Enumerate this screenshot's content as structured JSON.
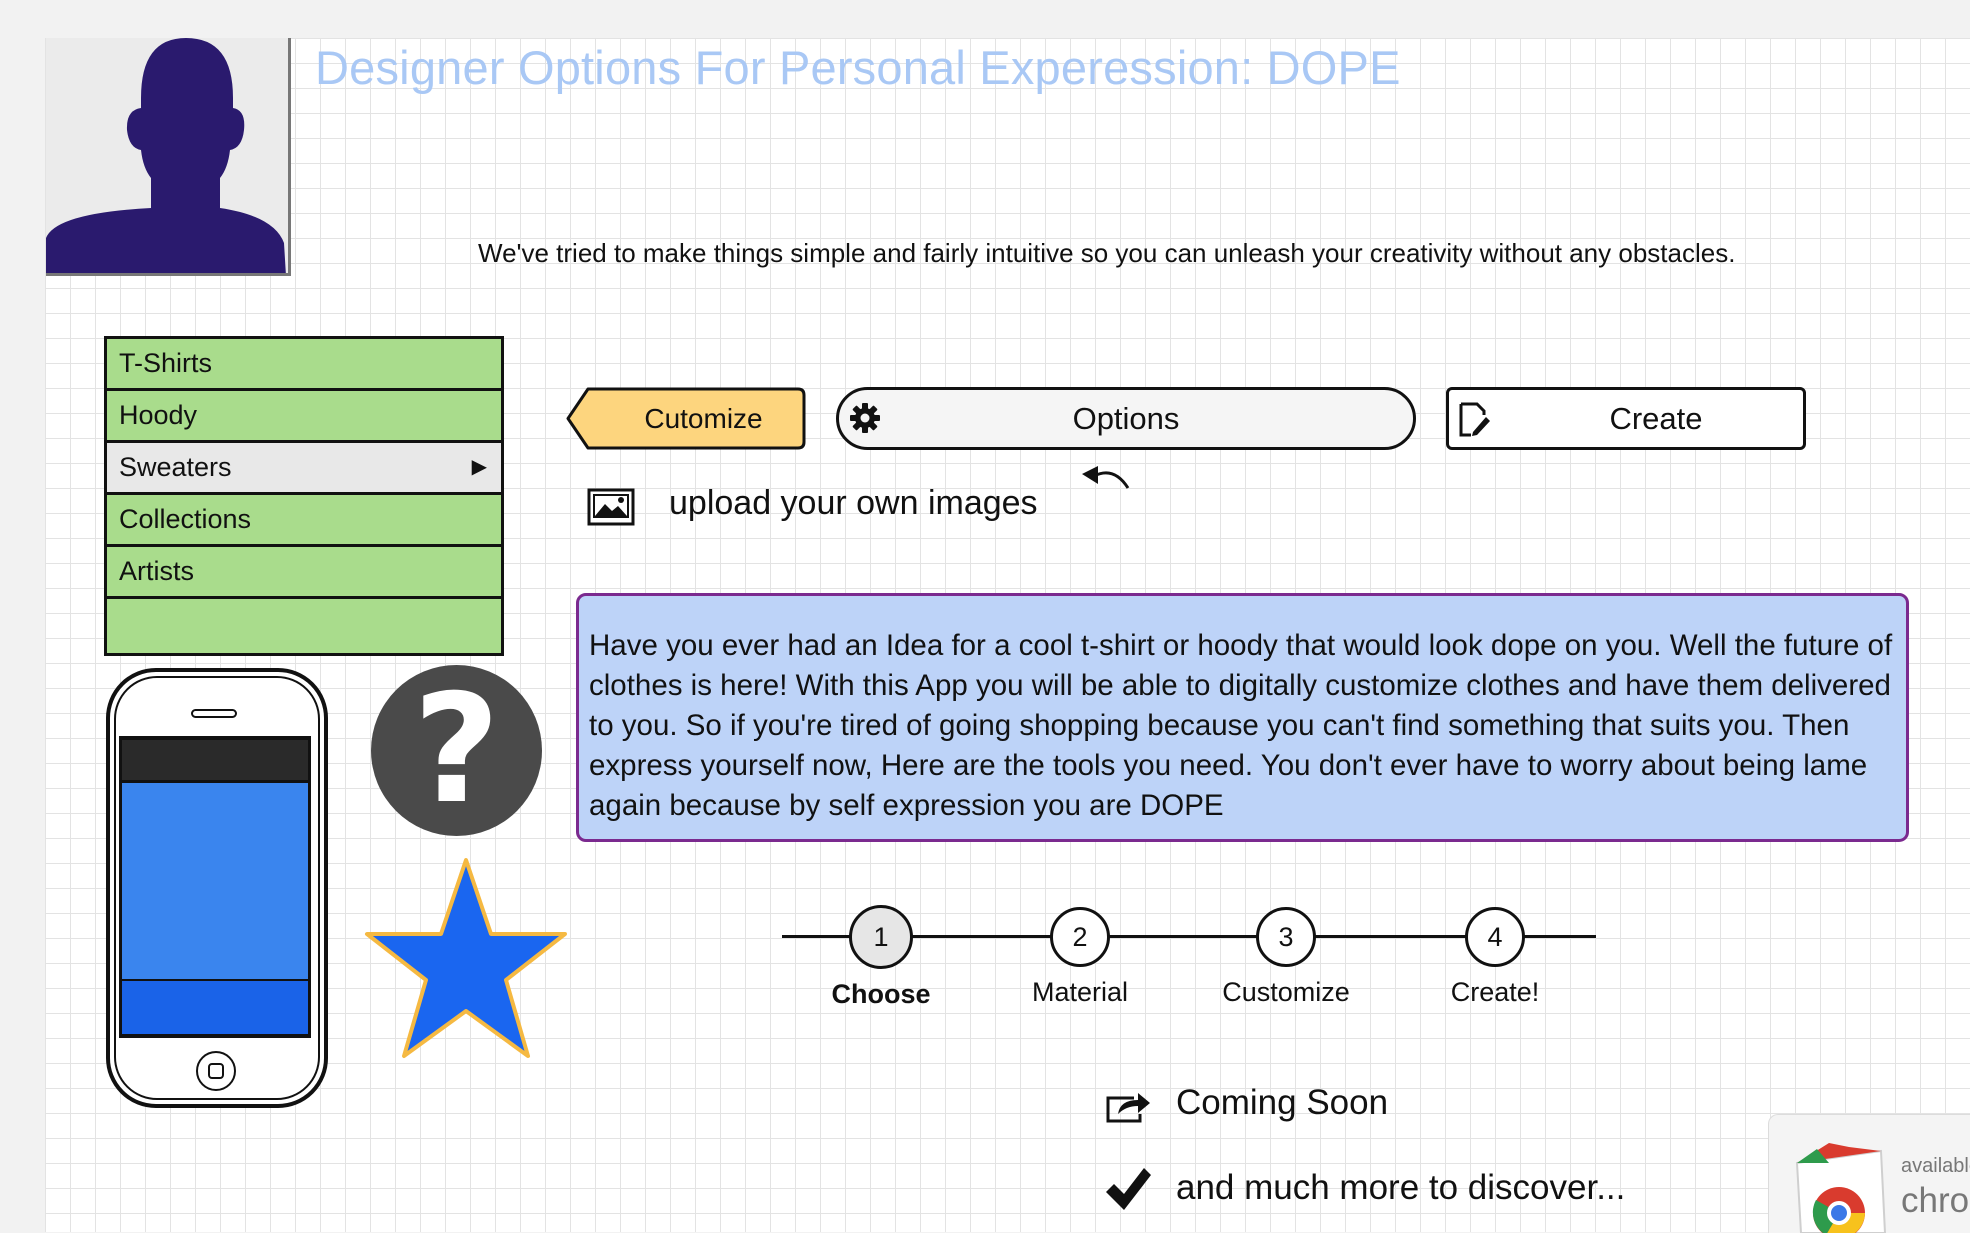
{
  "header": {
    "title": "Designer Options For Personal Experession: DOPE",
    "subtitle": "We've tried to make things simple and fairly intuitive so you can unleash your creativity without any obstacles."
  },
  "avatar": {
    "icon": "person-silhouette-icon",
    "color": "#2a1a6e"
  },
  "menu": {
    "items": [
      {
        "label": "T-Shirts"
      },
      {
        "label": "Hoody"
      },
      {
        "label": "Sweaters",
        "selected": true,
        "has_submenu": true
      },
      {
        "label": "Collections"
      },
      {
        "label": "Artists"
      }
    ],
    "submenu_arrow": "▶"
  },
  "icons": {
    "phone": "smartphone-icon",
    "help": "question-mark-icon",
    "help_glyph": "?",
    "star": "star-icon"
  },
  "toolbar": {
    "customize_label": "Cutomize",
    "options_label": "Options",
    "create_label": "Create"
  },
  "upload": {
    "label": "upload your own images"
  },
  "description": "Have you ever had an Idea for a cool t-shirt or hoody that would look dope on you. Well the future of clothes is here! With this App you will be able to digitally customize clothes and have them delivered to you. So if you're tired of going shopping because you can't find something that suits you. Then express yourself now, Here are the tools you need. You don't ever have to worry about being lame again because by self expression you are DOPE",
  "steps": [
    {
      "number": "1",
      "label": "Choose",
      "active": true
    },
    {
      "number": "2",
      "label": "Material"
    },
    {
      "number": "3",
      "label": "Customize"
    },
    {
      "number": "4",
      "label": "Create!"
    }
  ],
  "features": {
    "coming_soon": "Coming Soon",
    "more": "and much more to discover..."
  },
  "chrome_badge": {
    "line1": "available",
    "line2": "chrome"
  },
  "colors": {
    "menu_green": "#a9dc8c",
    "title_blue": "#a9c8f5",
    "description_bg": "#bdd3f8",
    "description_border": "#7b2a8f",
    "customize_yellow": "#fdd57e",
    "star_blue": "#1a66f0",
    "star_outline": "#f5b942",
    "avatar_purple": "#2a1a6e"
  }
}
